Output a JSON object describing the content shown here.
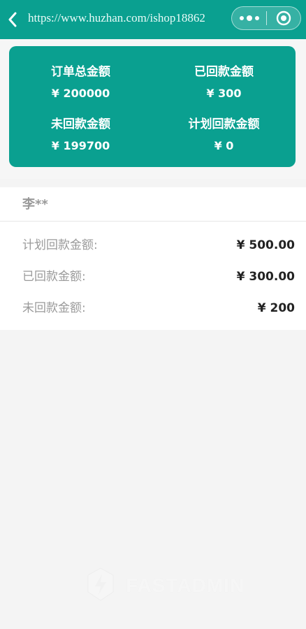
{
  "nav": {
    "back_icon": "chevron-left-icon",
    "url": "https://www.huzhan.com/ishop18862",
    "more_icon": "more-dots-icon",
    "close_icon": "target-circle-icon",
    "bar_color": "#0aa090"
  },
  "summary": {
    "items": [
      {
        "label": "订单总金额",
        "value": "¥ 200000"
      },
      {
        "label": "已回款金额",
        "value": "¥ 300"
      },
      {
        "label": "未回款金额",
        "value": "¥ 199700"
      },
      {
        "label": "计划回款金额",
        "value": "¥ 0"
      }
    ]
  },
  "detail": {
    "name": "李**",
    "rows": [
      {
        "label": "计划回款金额:",
        "value": "¥ 500.00"
      },
      {
        "label": "已回款金额:",
        "value": "¥ 300.00"
      },
      {
        "label": "未回款金额:",
        "value": "¥ 200"
      }
    ]
  },
  "watermark": {
    "icon": "fastadmin-logo-icon",
    "text": "FASTADMIN"
  }
}
